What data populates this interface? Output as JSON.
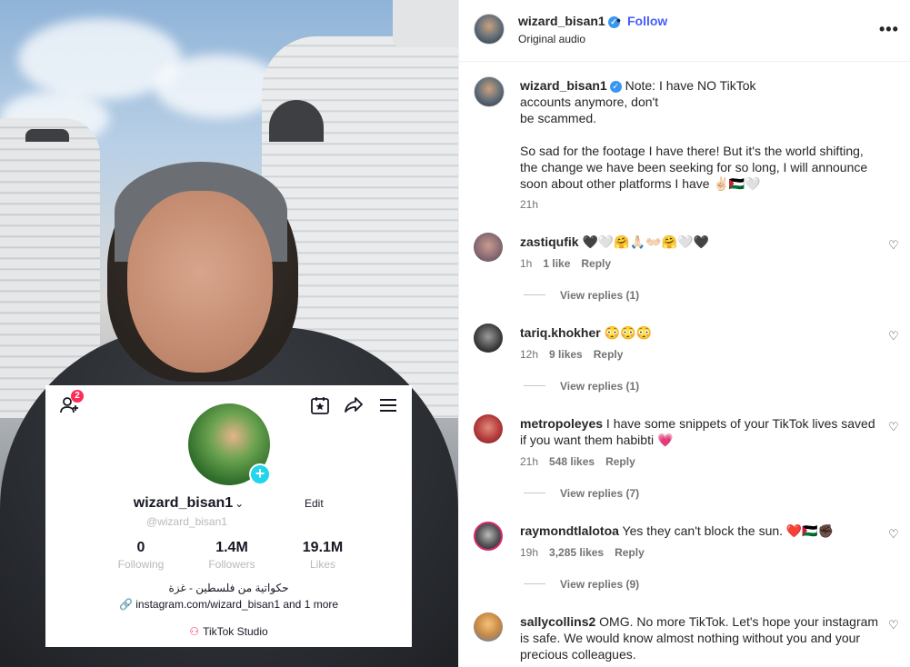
{
  "header": {
    "username": "wizard_bisan1",
    "dot": "•",
    "follow_label": "Follow",
    "subtitle": "Original audio",
    "more": "•••",
    "verified_mark": "✓"
  },
  "caption": {
    "username": "wizard_bisan1",
    "line1": " Note: I have NO TikTok",
    "line2": "accounts anymore, don't",
    "line3": "be scammed.",
    "line4": "So sad for the footage I have there! But it's the world shifting,",
    "line5": "the change we have been seeking for so long, I will announce",
    "line6": "soon about other platforms I have ✌🏻🇵🇸🤍",
    "time": "21h"
  },
  "comments": [
    {
      "username": "zastiqufik",
      "text": " 🖤🤍🤗🙏🏻👐🏻🤗🤍🖤",
      "time": "1h",
      "likes": "1 like",
      "reply": "Reply",
      "replies": "View replies (1)",
      "heart": "♡"
    },
    {
      "username": "tariq.khokher",
      "text": " 😳😳😳",
      "time": "12h",
      "likes": "9 likes",
      "reply": "Reply",
      "replies": "View replies (1)",
      "heart": "♡"
    },
    {
      "username": "metropoleyes",
      "text_line1": " I have some snippets of your TikTok lives saved",
      "text_line2": "if you want them habibti 💗",
      "time": "21h",
      "likes": "548 likes",
      "reply": "Reply",
      "replies": "View replies (7)",
      "heart": "♡"
    },
    {
      "username": "raymondtlalotoa",
      "text": " Yes they can't block the sun. ❤️🇵🇸✊🏿",
      "time": "19h",
      "likes": "3,285 likes",
      "reply": "Reply",
      "replies": "View replies (9)",
      "heart": "♡"
    },
    {
      "username": "sallycollins2",
      "text_line1": " OMG. No more TikTok. Let's hope your instagram",
      "text_line2": "is safe. We would know almost nothing without you and your",
      "text_line3": "precious colleagues.",
      "heart": "♡"
    }
  ],
  "tiktok_card": {
    "notif_count": "2",
    "username": "wizard_bisan1",
    "chevron": "⌄",
    "edit_label": "Edit",
    "handle": "@wizard_bisan1",
    "following_count": "0",
    "following_label": "Following",
    "followers_count": "1.4M",
    "followers_label": "Followers",
    "likes_count": "19.1M",
    "likes_label": "Likes",
    "bio": "حكواتية من فلسطين - غزة",
    "link_text": "instagram.com/wizard_bisan1",
    "link_more": " and 1 more",
    "studio_label": "TikTok Studio",
    "plus": "+"
  },
  "colors": {
    "follow": "#4a5df9",
    "verified": "#3897f0",
    "tiktok_pink": "#fe2c55",
    "tiktok_cyan": "#20d5ec"
  }
}
